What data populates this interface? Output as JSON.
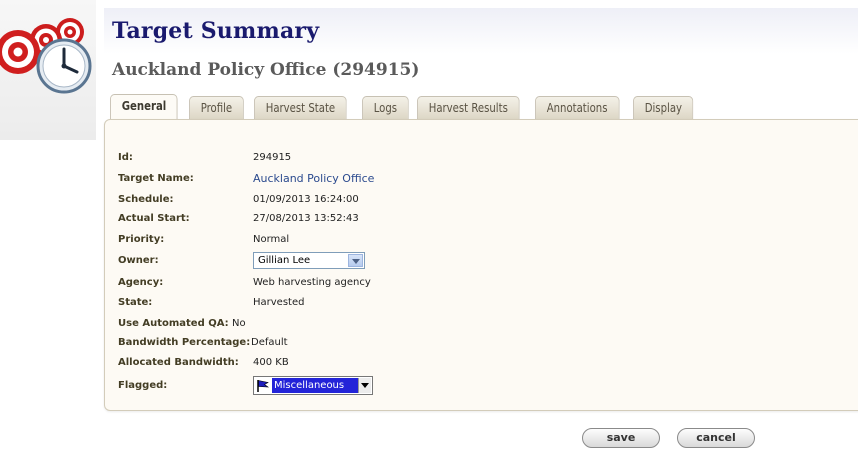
{
  "header": {
    "title": "Target Summary",
    "subtitle": "Auckland Policy Office (294915)"
  },
  "tabs": [
    {
      "label": "General",
      "active": true
    },
    {
      "label": "Profile"
    },
    {
      "label": "Harvest State"
    },
    {
      "label": "Logs"
    },
    {
      "label": "Harvest Results"
    },
    {
      "label": "Annotations"
    },
    {
      "label": "Display"
    }
  ],
  "fields": {
    "id": {
      "label": "Id:",
      "value": "294915"
    },
    "target_name": {
      "label": "Target Name:",
      "value": "Auckland Policy Office"
    },
    "schedule": {
      "label": "Schedule:",
      "value": "01/09/2013 16:24:00"
    },
    "actual_start": {
      "label": "Actual Start:",
      "value": "27/08/2013 13:52:43"
    },
    "priority": {
      "label": "Priority:",
      "value": "Normal"
    },
    "owner": {
      "label": "Owner:",
      "value": "Gillian Lee"
    },
    "agency": {
      "label": "Agency:",
      "value": "Web harvesting agency"
    },
    "state": {
      "label": "State:",
      "value": "Harvested"
    },
    "use_automated_qa": {
      "label": "Use Automated QA:",
      "value": "No"
    },
    "bandwidth_percentage": {
      "label": "Bandwidth Percentage:",
      "value": "Default"
    },
    "allocated_bandwidth": {
      "label": "Allocated Bandwidth:",
      "value": "400 KB"
    },
    "flagged": {
      "label": "Flagged:",
      "value": "Miscellaneous"
    }
  },
  "buttons": {
    "save": "save",
    "cancel": "cancel"
  },
  "colors": {
    "title": "#1a1a6e",
    "subtitle": "#5a5a5a",
    "label": "#433d24",
    "link": "#2b4a8e",
    "flag_selection": "#2323d8",
    "panel_bg": "#fdfaf4"
  },
  "icons": {
    "logo": "targets-with-clock-logo",
    "flag": "blue-flag-icon"
  }
}
